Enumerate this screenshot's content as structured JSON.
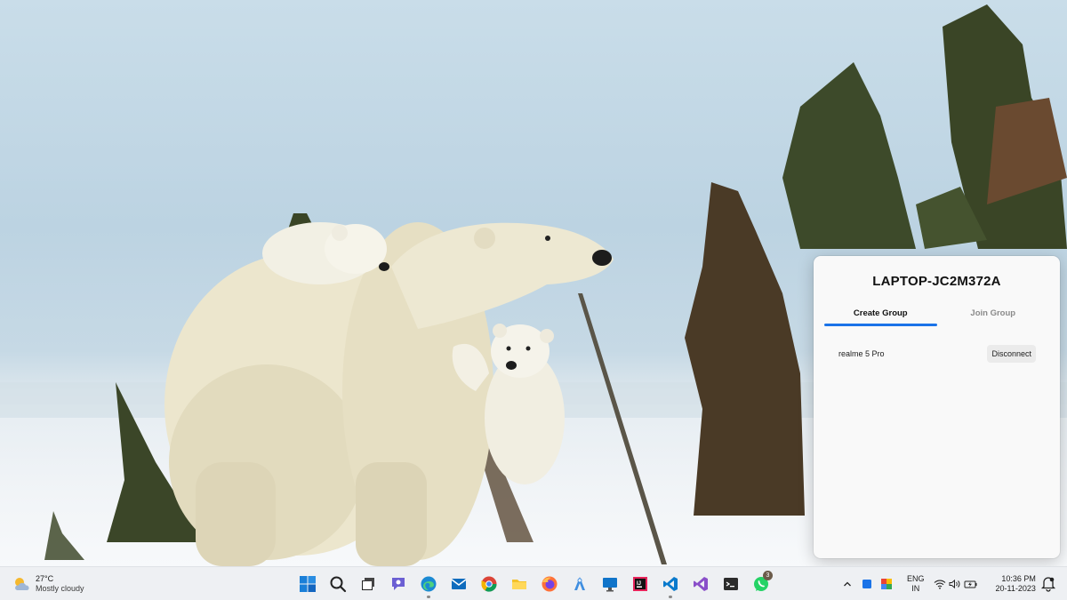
{
  "panel": {
    "title": "LAPTOP-JC2M372A",
    "tabs": [
      {
        "label": "Create Group",
        "active": true
      },
      {
        "label": "Join Group",
        "active": false
      }
    ],
    "devices": [
      {
        "name": "realme 5 Pro",
        "action_label": "Disconnect"
      }
    ],
    "accent_color": "#1a73e8"
  },
  "taskbar": {
    "weather": {
      "temperature": "27°C",
      "description": "Mostly cloudy",
      "icon": "partly-cloudy-icon"
    },
    "apps": [
      {
        "name": "start",
        "icon": "windows-start-icon"
      },
      {
        "name": "search",
        "icon": "search-icon"
      },
      {
        "name": "task-view",
        "icon": "task-view-icon"
      },
      {
        "name": "chat",
        "icon": "teams-chat-icon"
      },
      {
        "name": "edge",
        "icon": "edge-icon",
        "running": true
      },
      {
        "name": "mail",
        "icon": "mail-icon"
      },
      {
        "name": "chrome",
        "icon": "chrome-icon"
      },
      {
        "name": "file-explorer",
        "icon": "folder-icon"
      },
      {
        "name": "firefox",
        "icon": "firefox-icon"
      },
      {
        "name": "android-studio",
        "icon": "android-studio-icon"
      },
      {
        "name": "remote-desktop",
        "icon": "monitor-icon"
      },
      {
        "name": "jetbrains",
        "icon": "jetbrains-icon"
      },
      {
        "name": "vs-code",
        "icon": "vscode-icon",
        "running": true
      },
      {
        "name": "visual-studio",
        "icon": "visual-studio-icon"
      },
      {
        "name": "terminal",
        "icon": "terminal-icon"
      },
      {
        "name": "whatsapp",
        "icon": "whatsapp-icon",
        "badge": "3"
      }
    ],
    "tray": {
      "language_line1": "ENG",
      "language_line2": "IN",
      "time": "10:36 PM",
      "date": "20-11-2023"
    }
  }
}
